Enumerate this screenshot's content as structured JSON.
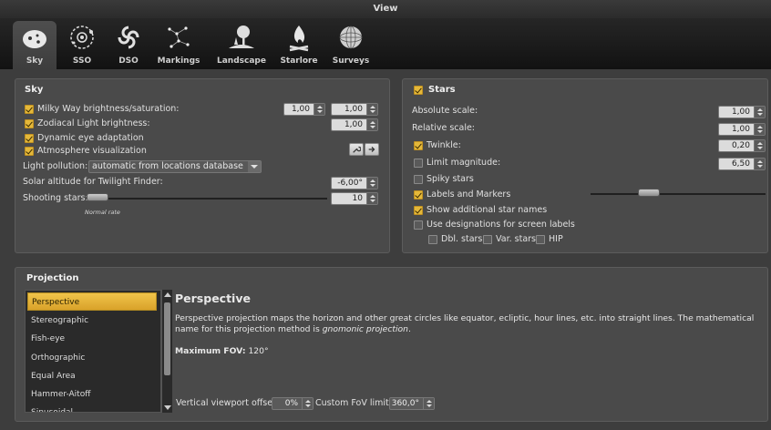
{
  "window": {
    "title": "View"
  },
  "tabs": [
    {
      "label": "Sky",
      "icon": "sky-icon",
      "active": true
    },
    {
      "label": "SSO",
      "icon": "sso-icon"
    },
    {
      "label": "DSO",
      "icon": "dso-galaxy-icon"
    },
    {
      "label": "Markings",
      "icon": "markings-constellation-icon"
    },
    {
      "label": "Landscape",
      "icon": "landscape-tree-icon"
    },
    {
      "label": "Starlore",
      "icon": "starlore-campfire-icon"
    },
    {
      "label": "Surveys",
      "icon": "surveys-sphere-icon"
    }
  ],
  "sky": {
    "heading": "Sky",
    "milky_way": {
      "label": "Milky Way brightness/saturation:",
      "checked": true,
      "value1": "1,00",
      "value2": "1,00"
    },
    "zodiacal": {
      "label": "Zodiacal Light brightness:",
      "checked": true,
      "value": "1,00"
    },
    "dynamic_eye": {
      "label": "Dynamic eye adaptation",
      "checked": true
    },
    "atmosphere": {
      "label": "Atmosphere visualization",
      "checked": true
    },
    "light_pollution": {
      "label": "Light pollution:",
      "value": "automatic from locations database"
    },
    "solar_altitude": {
      "label": "Solar altitude for Twilight Finder:",
      "value": "-6,00°"
    },
    "shooting_stars": {
      "label": "Shooting stars:",
      "value": "10",
      "rate_label": "Normal rate"
    }
  },
  "stars": {
    "heading": "Stars",
    "checked": true,
    "absolute_scale": {
      "label": "Absolute scale:",
      "value": "1,00"
    },
    "relative_scale": {
      "label": "Relative scale:",
      "value": "1,00"
    },
    "twinkle": {
      "label": "Twinkle:",
      "checked": true,
      "value": "0,20"
    },
    "limit_magnitude": {
      "label": "Limit magnitude:",
      "checked": false,
      "value": "6,50"
    },
    "spiky": {
      "label": "Spiky stars",
      "checked": false
    },
    "labels_markers": {
      "label": "Labels and Markers",
      "checked": true
    },
    "additional_names": {
      "label": "Show additional star names",
      "checked": true
    },
    "designations": {
      "label": "Use designations for screen labels",
      "checked": false
    },
    "dbl": {
      "label": "Dbl. stars",
      "checked": false
    },
    "var": {
      "label": "Var. stars",
      "checked": false
    },
    "hip": {
      "label": "HIP",
      "checked": false
    }
  },
  "projection": {
    "heading": "Projection",
    "items": [
      "Perspective",
      "Stereographic",
      "Fish-eye",
      "Orthographic",
      "Equal Area",
      "Hammer-Aitoff",
      "Sinusoidal"
    ],
    "selected": "Perspective",
    "title": "Perspective",
    "description_a": "Perspective projection maps the horizon and other great circles like equator, ecliptic, hour lines, etc. into straight lines. The mathematical name for this projection method is ",
    "description_em": "gnomonic projection",
    "description_b": ".",
    "max_fov_label": "Maximum FOV:",
    "max_fov_value": "120°",
    "viewport_offset_label": "Vertical viewport offset",
    "viewport_offset_value": "0%",
    "custom_fov_label": "Custom FoV limit",
    "custom_fov_value": "360,0°"
  }
}
